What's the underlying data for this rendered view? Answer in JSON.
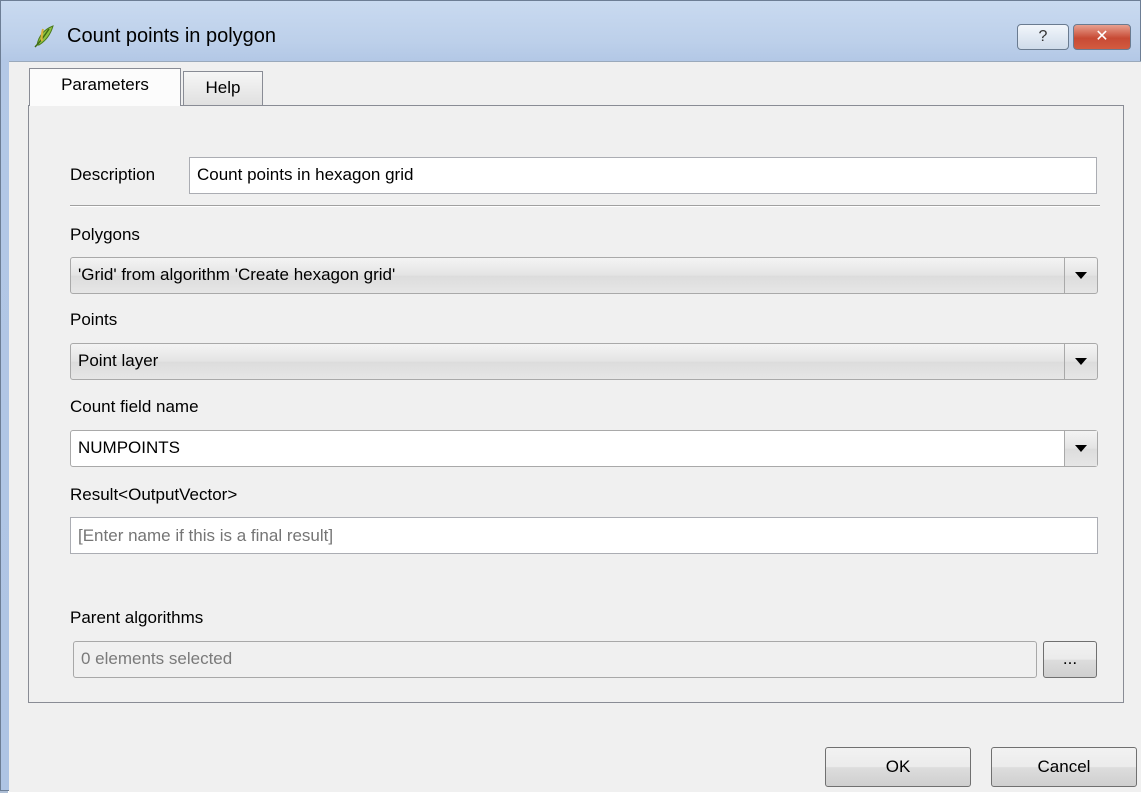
{
  "window": {
    "title": "Count points in polygon",
    "help_button": "?",
    "close_button": "✕"
  },
  "tabs": [
    {
      "label": "Parameters",
      "active": true
    },
    {
      "label": "Help",
      "active": false
    }
  ],
  "form": {
    "description_label": "Description",
    "description_value": "Count points in hexagon grid",
    "polygons_label": "Polygons",
    "polygons_value": "'Grid' from algorithm 'Create hexagon grid'",
    "points_label": "Points",
    "points_value": "Point layer",
    "count_field_label": "Count field name",
    "count_field_value": "NUMPOINTS",
    "result_label": "Result<OutputVector>",
    "result_value": "",
    "result_placeholder": "[Enter name if this is a final result]",
    "parent_label": "Parent algorithms",
    "parent_value": "0 elements selected",
    "parent_browse": "..."
  },
  "buttons": {
    "ok": "OK",
    "cancel": "Cancel"
  },
  "icons": {
    "app": "qgis-leaf-icon",
    "dropdown": "chevron-down-icon"
  }
}
